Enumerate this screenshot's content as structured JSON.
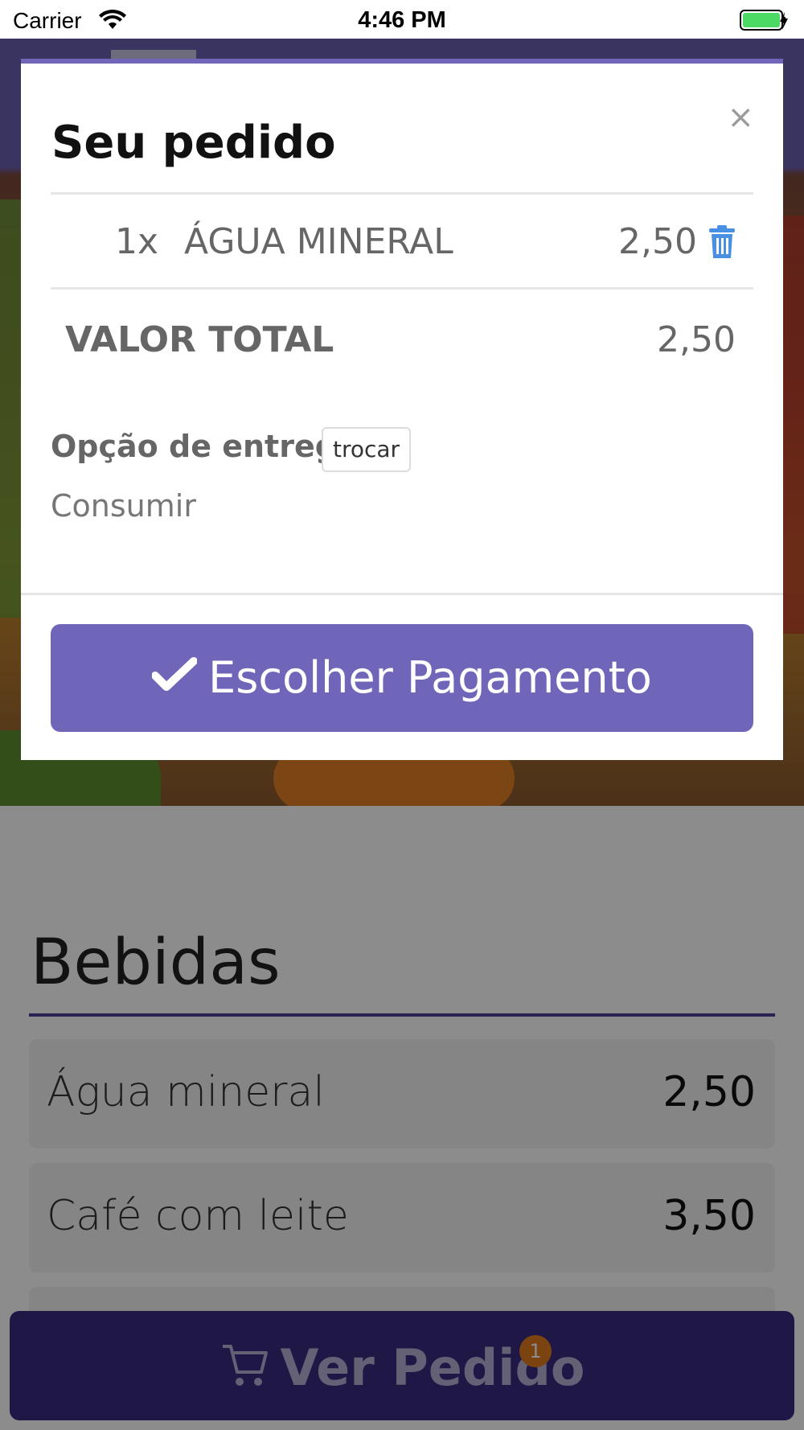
{
  "status_bar": {
    "carrier": "Carrier",
    "time": "4:46 PM",
    "battery_color": "#4cd964"
  },
  "background": {
    "section_title": "Bebidas",
    "items": [
      {
        "name": "Água mineral",
        "price": "2,50"
      },
      {
        "name": "Café com leite",
        "price": "3,50"
      }
    ],
    "cart_bar": {
      "label": "Ver Pedido",
      "badge_count": "1",
      "icon": "cart-icon"
    }
  },
  "modal": {
    "title": "Seu pedido",
    "close_glyph": "×",
    "order_items": [
      {
        "qty": "1x",
        "name": "ÁGUA MINERAL",
        "price": "2,50",
        "icon": "trash-icon"
      }
    ],
    "total_label": "VALOR TOTAL",
    "total_value": "2,50",
    "delivery_label": "Opção de entrega",
    "change_label": "trocar",
    "delivery_value": "Consumir",
    "pay_button": "Escolher Pagamento",
    "accent_color": "#7066b9"
  }
}
